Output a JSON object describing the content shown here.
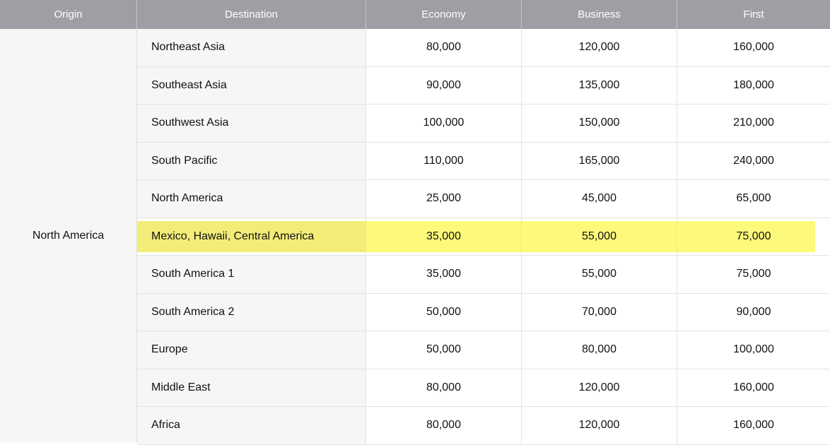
{
  "headers": {
    "origin": "Origin",
    "destination": "Destination",
    "economy": "Economy",
    "business": "Business",
    "first": "First"
  },
  "origin": "North America",
  "highlight_color": "#fdf97a",
  "header_color": "#9d9fa4",
  "rows": [
    {
      "destination": "Northeast Asia",
      "economy": "80,000",
      "business": "120,000",
      "first": "160,000"
    },
    {
      "destination": "Southeast Asia",
      "economy": "90,000",
      "business": "135,000",
      "first": "180,000"
    },
    {
      "destination": "Southwest Asia",
      "economy": "100,000",
      "business": "150,000",
      "first": "210,000"
    },
    {
      "destination": "South Pacific",
      "economy": "110,000",
      "business": "165,000",
      "first": "240,000"
    },
    {
      "destination": "North America",
      "economy": "25,000",
      "business": "45,000",
      "first": "65,000"
    },
    {
      "destination": "Mexico, Hawaii, Central America",
      "economy": "35,000",
      "business": "55,000",
      "first": "75,000",
      "highlighted": true
    },
    {
      "destination": "South America 1",
      "economy": "35,000",
      "business": "55,000",
      "first": "75,000"
    },
    {
      "destination": "South America 2",
      "economy": "50,000",
      "business": "70,000",
      "first": "90,000"
    },
    {
      "destination": "Europe",
      "economy": "50,000",
      "business": "80,000",
      "first": "100,000"
    },
    {
      "destination": "Middle East",
      "economy": "80,000",
      "business": "120,000",
      "first": "160,000"
    },
    {
      "destination": "Africa",
      "economy": "80,000",
      "business": "120,000",
      "first": "160,000"
    }
  ]
}
